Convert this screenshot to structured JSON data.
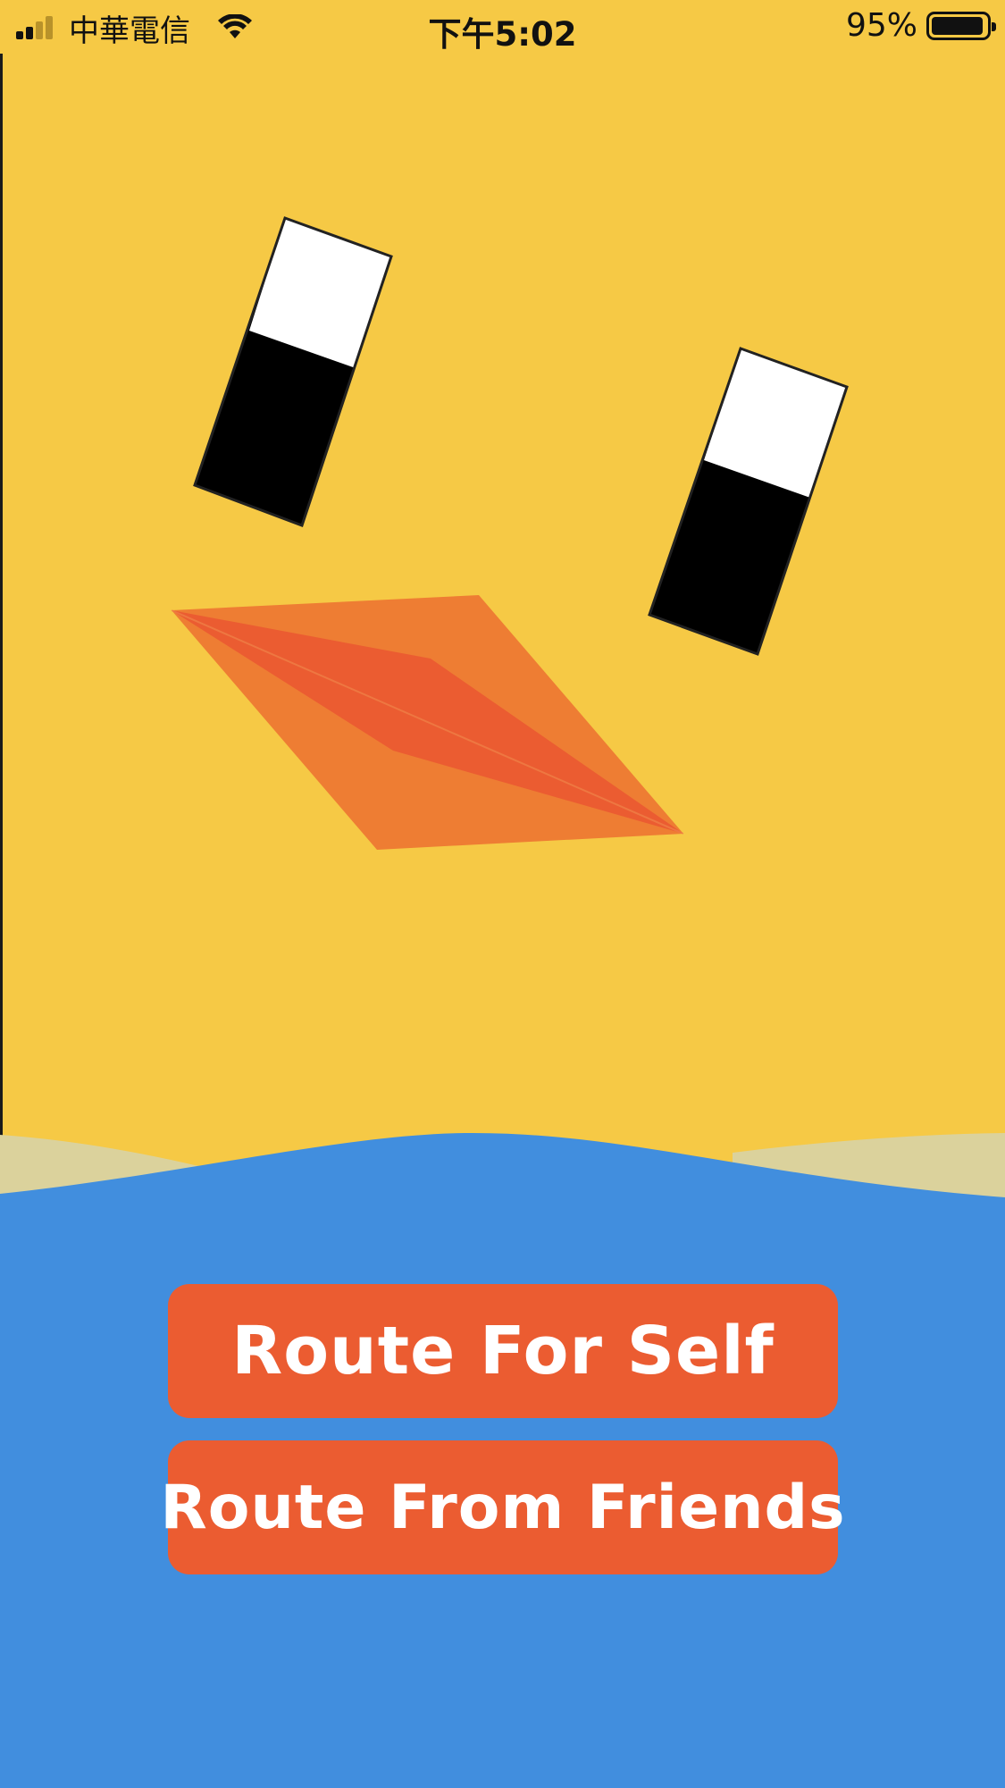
{
  "status_bar": {
    "carrier": "中華電信",
    "time": "下午5:02",
    "battery_percent": "95%",
    "battery_level": 0.95,
    "icons": [
      "signal-icon",
      "wifi-icon",
      "battery-icon"
    ]
  },
  "main": {
    "buttons": [
      {
        "label": "Route For Self"
      },
      {
        "label": "Route From Friends"
      }
    ]
  },
  "colors": {
    "background": "#f6c945",
    "water": "#418ede",
    "sand": "#dbd29c",
    "button": "#eb5c31",
    "beak_light": "#ee7d33",
    "beak_dark": "#eb5c31",
    "eye_black": "#000000",
    "eye_white": "#ffffff"
  }
}
